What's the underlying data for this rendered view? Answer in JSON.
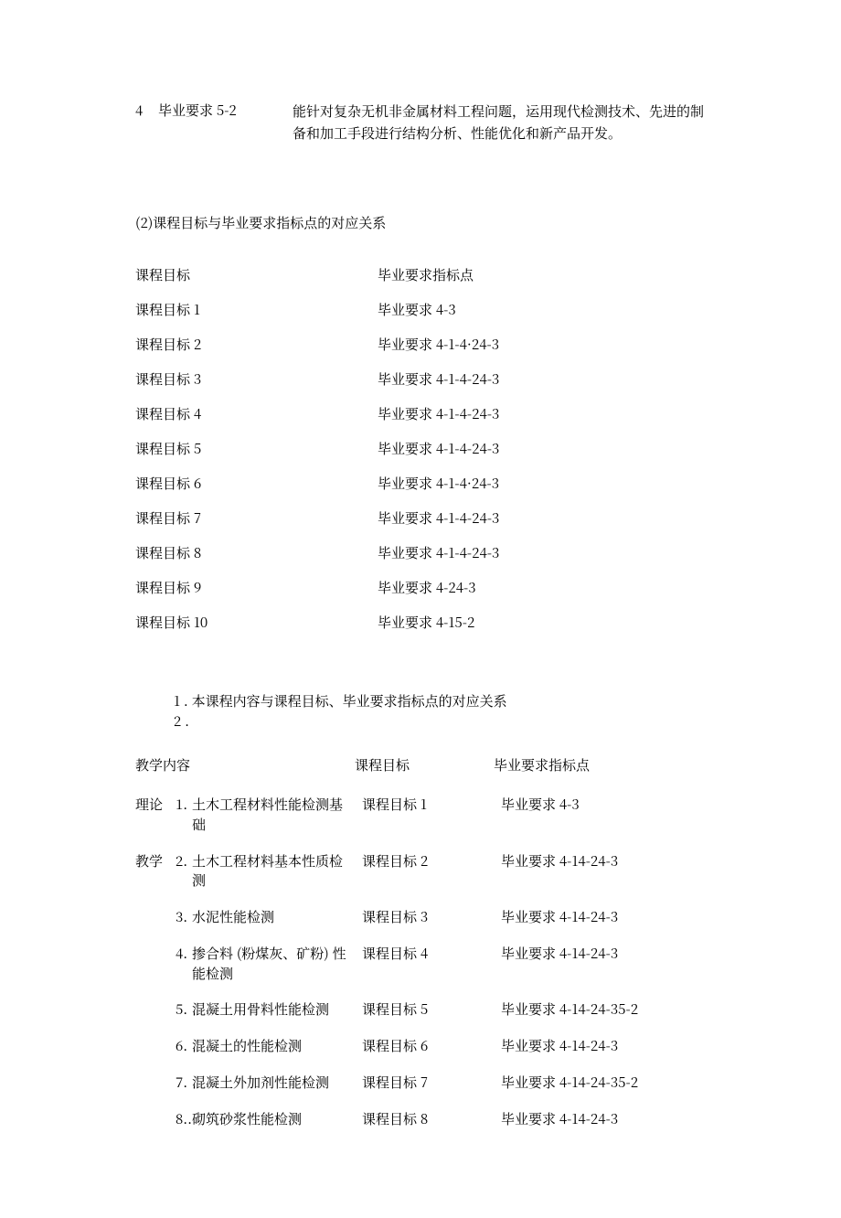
{
  "top": {
    "num": "4",
    "req": "毕业要求 5-2",
    "desc": "能针对复杂无机非金属材料工程问题，运用现代检测技术、先进的制备和加工手段进行结构分析、性能优化和新产品开发。"
  },
  "section2_title": "(2)课程目标与毕业要求指标点的对应关系",
  "map": {
    "head_left": "课程目标",
    "head_right": "毕业要求指标点",
    "rows": [
      {
        "left": "课程目标 1",
        "right": "毕业要求 4-3"
      },
      {
        "left": "课程目标 2",
        "right": "毕业要求 4-1-4·24-3"
      },
      {
        "left": "课程目标 3",
        "right": "毕业要求 4-1-4-24-3"
      },
      {
        "left": "课程目标 4",
        "right": "毕业要求 4-1-4-24-3"
      },
      {
        "left": "课程目标 5",
        "right": "毕业要求 4-1-4-24-3"
      },
      {
        "left": "课程目标 6",
        "right": "毕业要求 4-1-4·24-3"
      },
      {
        "left": "课程目标 7",
        "right": "毕业要求 4-1-4-24-3"
      },
      {
        "left": "课程目标 8",
        "right": "毕业要求 4-1-4-24-3"
      },
      {
        "left": "课程目标 9",
        "right": "毕业要求 4-24-3"
      },
      {
        "left": "课程目标 10",
        "right": "毕业要求 4-15-2"
      }
    ]
  },
  "content_title": "1 . 本课程内容与课程目标、毕业要求指标点的对应关系",
  "content_two": "2 .",
  "content": {
    "header_teach": "教学内容",
    "header_goal": "课程目标",
    "header_req": "毕业要求指标点",
    "cat_theory": "理论",
    "cat_teach": "教学",
    "rows": [
      {
        "cat": "理论",
        "num": "1.",
        "name": "土木工程材料性能检测基础",
        "goal": "课程目标 1",
        "req": "毕业要求 4-3"
      },
      {
        "cat": "教学",
        "num": "2.",
        "name": "土木工程材料基本性质检测",
        "goal": "课程目标 2",
        "req": "毕业要求 4-14-24-3"
      },
      {
        "cat": "",
        "num": "3.",
        "name": "水泥性能检测",
        "goal": "课程目标 3",
        "req": "毕业要求 4-14-24-3"
      },
      {
        "cat": "",
        "num": "4.",
        "name": "掺合料 (粉煤灰、矿粉) 性能检测",
        "goal": "课程目标 4",
        "req": "毕业要求 4-14-24-3"
      },
      {
        "cat": "",
        "num": "5.",
        "name": " 混凝土用骨料性能检测",
        "goal": "课程目标 5",
        "req": "毕业要求 4-14-24-35-2"
      },
      {
        "cat": "",
        "num": "6.",
        "name": " 混凝土的性能检测",
        "goal": "课程目标 6",
        "req": "毕业要求 4-14-24-3"
      },
      {
        "cat": "",
        "num": "7.",
        "name": " 混凝土外加剂性能检测",
        "goal": "课程目标 7",
        "req": "毕业要求 4-14-24-35-2"
      },
      {
        "cat": "",
        "num": "8..",
        "name": "砌筑砂浆性能检测",
        "goal": "课程目标 8",
        "req": "毕业要求 4-14-24-3"
      }
    ]
  }
}
